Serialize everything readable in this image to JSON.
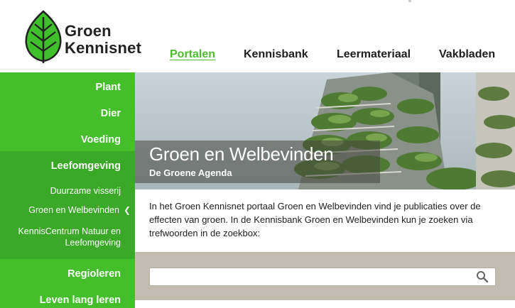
{
  "brand": {
    "line1": "Groen",
    "line2": "Kennisnet",
    "leaf_color": "#3fbf2b"
  },
  "nav": {
    "items": [
      {
        "label": "Portalen",
        "active": true
      },
      {
        "label": "Kennisbank",
        "active": false
      },
      {
        "label": "Leermateriaal",
        "active": false
      },
      {
        "label": "Vakbladen",
        "active": false
      }
    ]
  },
  "sidebar": {
    "items": [
      {
        "label": "Plant"
      },
      {
        "label": "Dier"
      },
      {
        "label": "Voeding"
      },
      {
        "label": "Leefomgeving"
      }
    ],
    "subitems": [
      {
        "label": "Duurzame visserij"
      },
      {
        "label": "Groen en Welbevinden",
        "current": true
      },
      {
        "label_line1": "KennisCentrum Natuur en",
        "label_line2": "Leefomgeving"
      }
    ],
    "bottom_items": [
      {
        "label": "Regioleren"
      },
      {
        "label": "Leven lang leren"
      }
    ]
  },
  "hero": {
    "title": "Groen en Welbevinden",
    "subtitle": "De Groene Agenda"
  },
  "intro": {
    "text": "In het Groen Kennisnet portaal Groen en Welbevinden vind je publicaties over de effecten van groen. In de Kennisbank Groen en Welbevinden kun je zoeken via trefwoorden in de zoekbox:"
  },
  "search": {
    "value": "",
    "placeholder": "",
    "icon": "search-icon"
  },
  "colors": {
    "accent": "#44bf2b",
    "sidebar_sub": "#3aa927",
    "search_band": "#c3bcb0"
  }
}
